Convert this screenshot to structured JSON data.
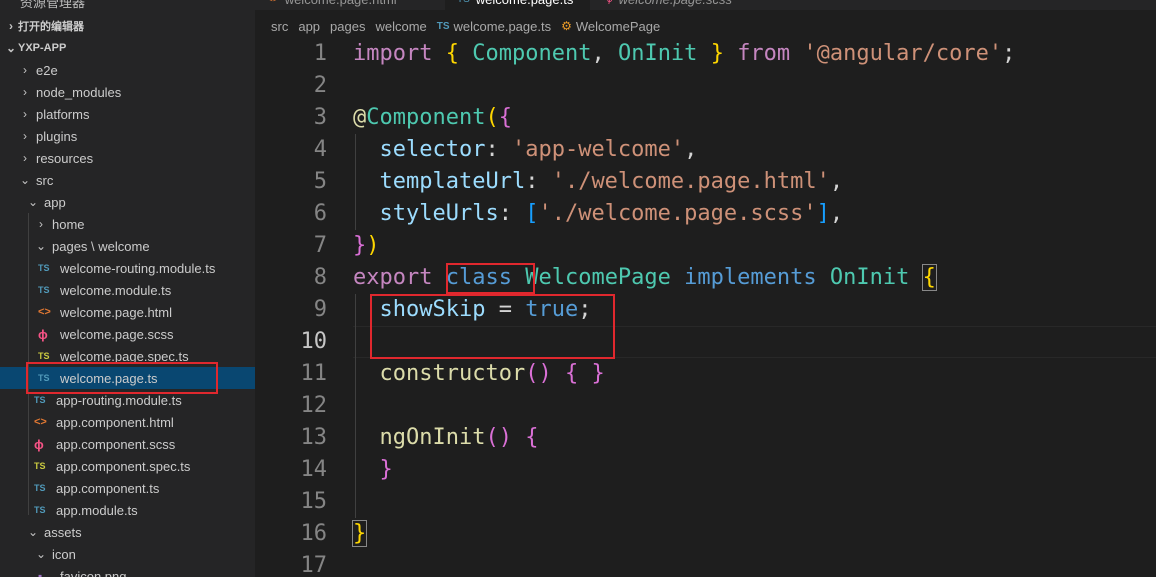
{
  "sidebar": {
    "top_label": "资源管理器",
    "open_editors_label": "打开的编辑器",
    "project_label": "YXP-APP",
    "tree": [
      {
        "label": "e2e",
        "type": "folder",
        "expanded": false,
        "depth": 1
      },
      {
        "label": "node_modules",
        "type": "folder",
        "expanded": false,
        "depth": 1
      },
      {
        "label": "platforms",
        "type": "folder",
        "expanded": false,
        "depth": 1
      },
      {
        "label": "plugins",
        "type": "folder",
        "expanded": false,
        "depth": 1
      },
      {
        "label": "resources",
        "type": "folder",
        "expanded": false,
        "depth": 1
      },
      {
        "label": "src",
        "type": "folder",
        "expanded": true,
        "depth": 1
      },
      {
        "label": "app",
        "type": "folder",
        "expanded": true,
        "depth": 2
      },
      {
        "label": "home",
        "type": "folder",
        "expanded": false,
        "depth": 3
      },
      {
        "label": "pages \\ welcome",
        "type": "folder",
        "expanded": true,
        "depth": 3
      },
      {
        "label": "welcome-routing.module.ts",
        "type": "ts",
        "depth": 4
      },
      {
        "label": "welcome.module.ts",
        "type": "ts",
        "depth": 4
      },
      {
        "label": "welcome.page.html",
        "type": "html",
        "depth": 4
      },
      {
        "label": "welcome.page.scss",
        "type": "scss",
        "depth": 4
      },
      {
        "label": "welcome.page.spec.ts",
        "type": "tsspec",
        "depth": 4
      },
      {
        "label": "welcome.page.ts",
        "type": "ts",
        "depth": 4,
        "selected": true
      },
      {
        "label": "app-routing.module.ts",
        "type": "ts",
        "depth": 3
      },
      {
        "label": "app.component.html",
        "type": "html",
        "depth": 3
      },
      {
        "label": "app.component.scss",
        "type": "scss",
        "depth": 3
      },
      {
        "label": "app.component.spec.ts",
        "type": "tsspec",
        "depth": 3
      },
      {
        "label": "app.component.ts",
        "type": "ts",
        "depth": 3
      },
      {
        "label": "app.module.ts",
        "type": "ts",
        "depth": 3
      },
      {
        "label": "assets",
        "type": "folder",
        "expanded": true,
        "depth": 2
      },
      {
        "label": "icon",
        "type": "folder",
        "expanded": true,
        "depth": 3
      },
      {
        "label": "favicon.png",
        "type": "png",
        "depth": 4
      }
    ],
    "icon_glyphs": {
      "ts": "TS",
      "tsspec": "TS",
      "html": "<>",
      "scss": "ϕ",
      "png": "▪"
    }
  },
  "tabs": [
    {
      "label": "welcome.page.html",
      "icon": "html-file-icon",
      "active": false
    },
    {
      "label": "welcome.page.ts",
      "icon": "ts-file-icon",
      "active": true
    },
    {
      "label": "welcome.page.scss",
      "icon": "scss-file-icon",
      "active": false
    }
  ],
  "breadcrumb": {
    "parts": [
      "src",
      "app",
      "pages",
      "welcome"
    ],
    "file_badge": "TS",
    "file": "welcome.page.ts",
    "symbol_glyph": "⚙",
    "symbol": "WelcomePage"
  },
  "editor": {
    "current_line": 10,
    "lines": [
      {
        "n": "1",
        "tokens": [
          [
            "kw",
            "import"
          ],
          [
            "pun",
            " "
          ],
          [
            "br1",
            "{"
          ],
          [
            "pun",
            " "
          ],
          [
            "cls",
            "Component"
          ],
          [
            "pun",
            ", "
          ],
          [
            "cls",
            "OnInit"
          ],
          [
            "pun",
            " "
          ],
          [
            "br1",
            "}"
          ],
          [
            "pun",
            " "
          ],
          [
            "kw",
            "from"
          ],
          [
            "pun",
            " "
          ],
          [
            "str",
            "'@angular/core'"
          ],
          [
            "pun",
            ";"
          ]
        ]
      },
      {
        "n": "2",
        "tokens": []
      },
      {
        "n": "3",
        "tokens": [
          [
            "fn",
            "@"
          ],
          [
            "cls",
            "Component"
          ],
          [
            "br1",
            "("
          ],
          [
            "br2",
            "{"
          ]
        ]
      },
      {
        "n": "4",
        "tokens": [
          [
            "pun",
            "  "
          ],
          [
            "prop",
            "selector"
          ],
          [
            "pun",
            ": "
          ],
          [
            "str",
            "'app-welcome'"
          ],
          [
            "pun",
            ","
          ]
        ]
      },
      {
        "n": "5",
        "tokens": [
          [
            "pun",
            "  "
          ],
          [
            "prop",
            "templateUrl"
          ],
          [
            "pun",
            ": "
          ],
          [
            "str",
            "'./welcome.page.html'"
          ],
          [
            "pun",
            ","
          ]
        ]
      },
      {
        "n": "6",
        "tokens": [
          [
            "pun",
            "  "
          ],
          [
            "prop",
            "styleUrls"
          ],
          [
            "pun",
            ": "
          ],
          [
            "br3",
            "["
          ],
          [
            "str",
            "'./welcome.page.scss'"
          ],
          [
            "br3",
            "]"
          ],
          [
            "pun",
            ","
          ]
        ]
      },
      {
        "n": "7",
        "tokens": [
          [
            "br2",
            "}"
          ],
          [
            "br1",
            ")"
          ]
        ]
      },
      {
        "n": "8",
        "tokens": [
          [
            "kw",
            "export"
          ],
          [
            "pun",
            " "
          ],
          [
            "kw2",
            "class"
          ],
          [
            "pun",
            " "
          ],
          [
            "cls",
            "WelcomePage"
          ],
          [
            "pun",
            " "
          ],
          [
            "kw2",
            "implements"
          ],
          [
            "pun",
            " "
          ],
          [
            "cls",
            "OnInit"
          ],
          [
            "pun",
            " "
          ],
          [
            "br1box",
            "{"
          ]
        ]
      },
      {
        "n": "9",
        "tokens": [
          [
            "pun",
            "  "
          ],
          [
            "var",
            "showSkip"
          ],
          [
            "pun",
            " = "
          ],
          [
            "kw2",
            "true"
          ],
          [
            "pun",
            ";"
          ]
        ]
      },
      {
        "n": "10",
        "tokens": []
      },
      {
        "n": "11",
        "tokens": [
          [
            "pun",
            "  "
          ],
          [
            "fn",
            "constructor"
          ],
          [
            "br2",
            "()"
          ],
          [
            "pun",
            " "
          ],
          [
            "br2",
            "{"
          ],
          [
            "pun",
            " "
          ],
          [
            "br2",
            "}"
          ]
        ]
      },
      {
        "n": "12",
        "tokens": []
      },
      {
        "n": "13",
        "tokens": [
          [
            "pun",
            "  "
          ],
          [
            "fn",
            "ngOnInit"
          ],
          [
            "br2",
            "()"
          ],
          [
            "pun",
            " "
          ],
          [
            "br2",
            "{"
          ]
        ]
      },
      {
        "n": "14",
        "tokens": [
          [
            "pun",
            "  "
          ],
          [
            "br2",
            "}"
          ]
        ]
      },
      {
        "n": "15",
        "tokens": []
      },
      {
        "n": "16",
        "tokens": [
          [
            "br1box",
            "}"
          ]
        ]
      },
      {
        "n": "17",
        "tokens": []
      }
    ]
  },
  "colors": {
    "annotation_red": "#e0282e",
    "selection_blue": "#094771",
    "editor_bg": "#1e1e1e",
    "sidebar_bg": "#252526"
  }
}
